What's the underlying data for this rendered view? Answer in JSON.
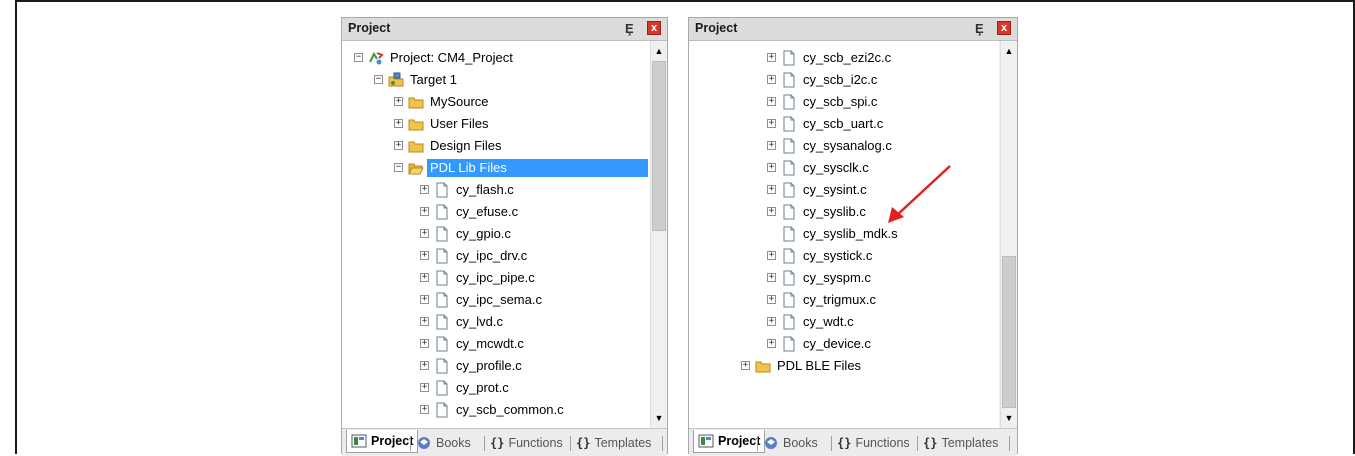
{
  "left_panel": {
    "title": "Project",
    "pin_glyph": "Ȩ",
    "close_glyph": "x",
    "tree": [
      {
        "label": "Project: CM4_Project",
        "icon": "project-icon",
        "expander": "−",
        "level": 0
      },
      {
        "label": "Target 1",
        "icon": "target-folder-icon",
        "expander": "−",
        "level": 1
      },
      {
        "label": "MySource",
        "icon": "folder-icon",
        "expander": "+",
        "level": 2
      },
      {
        "label": "User Files",
        "icon": "folder-icon",
        "expander": "+",
        "level": 2
      },
      {
        "label": "Design Files",
        "icon": "folder-icon",
        "expander": "+",
        "level": 2
      },
      {
        "label": "PDL Lib Files",
        "icon": "folder-open-icon",
        "expander": "−",
        "level": 2,
        "selected": true
      },
      {
        "label": "cy_flash.c",
        "icon": "file-icon",
        "expander": "+",
        "level": 3
      },
      {
        "label": "cy_efuse.c",
        "icon": "file-icon",
        "expander": "+",
        "level": 3
      },
      {
        "label": "cy_gpio.c",
        "icon": "file-icon",
        "expander": "+",
        "level": 3
      },
      {
        "label": "cy_ipc_drv.c",
        "icon": "file-icon",
        "expander": "+",
        "level": 3
      },
      {
        "label": "cy_ipc_pipe.c",
        "icon": "file-icon",
        "expander": "+",
        "level": 3
      },
      {
        "label": "cy_ipc_sema.c",
        "icon": "file-icon",
        "expander": "+",
        "level": 3
      },
      {
        "label": "cy_lvd.c",
        "icon": "file-icon",
        "expander": "+",
        "level": 3
      },
      {
        "label": "cy_mcwdt.c",
        "icon": "file-icon",
        "expander": "+",
        "level": 3
      },
      {
        "label": "cy_profile.c",
        "icon": "file-icon",
        "expander": "+",
        "level": 3
      },
      {
        "label": "cy_prot.c",
        "icon": "file-icon",
        "expander": "+",
        "level": 3
      },
      {
        "label": "cy_scb_common.c",
        "icon": "file-icon",
        "expander": "+",
        "level": 3
      }
    ],
    "tabs": [
      {
        "label": "Project",
        "icon": "project-tab-icon",
        "active": true
      },
      {
        "label": "Books",
        "icon": "books-icon"
      },
      {
        "label": "Functions",
        "icon": "functions-icon",
        "glyph": "{}"
      },
      {
        "label": "Templates",
        "icon": "templates-icon",
        "glyph": "{}"
      }
    ]
  },
  "right_panel": {
    "title": "Project",
    "pin_glyph": "Ȩ",
    "close_glyph": "x",
    "tree": [
      {
        "label": "cy_scb_ezi2c.c",
        "icon": "file-icon",
        "expander": "+",
        "level": 3
      },
      {
        "label": "cy_scb_i2c.c",
        "icon": "file-icon",
        "expander": "+",
        "level": 3
      },
      {
        "label": "cy_scb_spi.c",
        "icon": "file-icon",
        "expander": "+",
        "level": 3
      },
      {
        "label": "cy_scb_uart.c",
        "icon": "file-icon",
        "expander": "+",
        "level": 3
      },
      {
        "label": "cy_sysanalog.c",
        "icon": "file-icon",
        "expander": "+",
        "level": 3
      },
      {
        "label": "cy_sysclk.c",
        "icon": "file-icon",
        "expander": "+",
        "level": 3
      },
      {
        "label": "cy_sysint.c",
        "icon": "file-icon",
        "expander": "+",
        "level": 3
      },
      {
        "label": "cy_syslib.c",
        "icon": "file-icon",
        "expander": "+",
        "level": 3
      },
      {
        "label": "cy_syslib_mdk.s",
        "icon": "file-icon",
        "expander": "",
        "level": 3
      },
      {
        "label": "cy_systick.c",
        "icon": "file-icon",
        "expander": "+",
        "level": 3
      },
      {
        "label": "cy_syspm.c",
        "icon": "file-icon",
        "expander": "+",
        "level": 3
      },
      {
        "label": "cy_trigmux.c",
        "icon": "file-icon",
        "expander": "+",
        "level": 3
      },
      {
        "label": "cy_wdt.c",
        "icon": "file-icon",
        "expander": "+",
        "level": 3
      },
      {
        "label": "cy_device.c",
        "icon": "file-icon",
        "expander": "+",
        "level": 3
      },
      {
        "label": "PDL BLE Files",
        "icon": "folder-icon",
        "expander": "+",
        "level": 2
      }
    ],
    "tabs": [
      {
        "label": "Project",
        "icon": "project-tab-icon",
        "active": true
      },
      {
        "label": "Books",
        "icon": "books-icon"
      },
      {
        "label": "Functions",
        "icon": "functions-icon",
        "glyph": "{}"
      },
      {
        "label": "Templates",
        "icon": "templates-icon",
        "glyph": "{}"
      }
    ]
  },
  "colors": {
    "selection": "#3399ff",
    "folder": "#f2c34a",
    "annotation_arrow": "#e02020"
  }
}
